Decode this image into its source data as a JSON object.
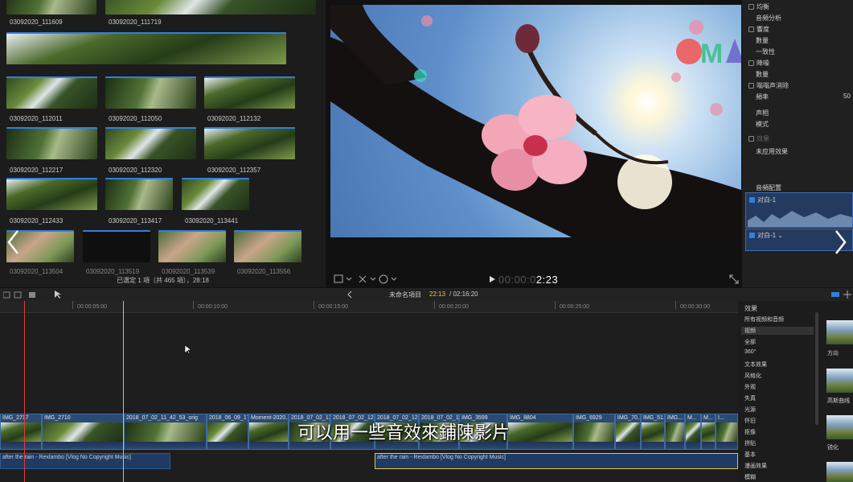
{
  "browser": {
    "clips": [
      {
        "name": "03092020_111609"
      },
      {
        "name": "03092020_111719"
      },
      {
        "name": "03092020_112011"
      },
      {
        "name": "03092020_112050"
      },
      {
        "name": "03092020_112132"
      },
      {
        "name": "03092020_112217"
      },
      {
        "name": "03092020_112320"
      },
      {
        "name": "03092020_112357"
      },
      {
        "name": "03092020_112433"
      },
      {
        "name": "03092020_113417"
      },
      {
        "name": "03092020_113441"
      },
      {
        "name": "03092020_113504"
      },
      {
        "name": "03092020_113519"
      },
      {
        "name": "03092020_113539"
      },
      {
        "name": "03092020_113556"
      }
    ],
    "status": "已選定 1 項（共 465 項），28:18"
  },
  "viewer": {
    "timecode_dim": "00:00:0",
    "timecode": "2:23",
    "logo_text": "OM"
  },
  "inspector": {
    "rows": [
      "均衡",
      "音頻分析",
      "響度",
      "數量",
      "一致性",
      "降噪",
      "數量",
      "嗡嗡声消除",
      "頻率",
      "声相",
      "模式",
      "效果",
      "未应用效果",
      "音頻配置"
    ],
    "freq_value": "50",
    "roles": [
      "对白-1",
      "对白-1"
    ]
  },
  "toolbar": {
    "project_name": "未命名項目",
    "time_current": "22:13",
    "time_total": "/ 02:16:20"
  },
  "timeline": {
    "ruler": [
      "00:00:05:00",
      "00:00:10:00",
      "00:00:15:00",
      "00:00:20:00",
      "00:00:25:00",
      "00:00:30:00"
    ],
    "video_clips": [
      "IMG_2717",
      "IMG_2710",
      "2018_07_02_11_42_53_orig",
      "2018_06_09_17...",
      "Moment-2020...",
      "2018_07_02_13...",
      "2018_07_02_12...",
      "2018_07_02_12...",
      "2018_07_02_11...",
      "IMG_3599",
      "IMG_8804",
      "IMG_6929",
      "IMG_70...",
      "IMG_51...",
      "IMG...",
      "M...",
      "M...",
      "I..."
    ],
    "audio_clips": [
      "after the rain - Rexlambo [Vlog No Copyright Music]",
      "after the rain - Rexlambo [Vlog No Copyright Music]"
    ],
    "subtitle": "可以用一些音效來鋪陳影片"
  },
  "effects": {
    "title": "效果",
    "items": [
      "所有视频和音频",
      "视频",
      "全部",
      "360°",
      "文本效果",
      "风格化",
      "外观",
      "失真",
      "光源",
      "怀旧",
      "抠像",
      "拼贴",
      "基本",
      "漫画效果",
      "模糊"
    ],
    "thumbs": [
      "方向",
      "高斯曲线",
      "锐化"
    ]
  },
  "colors": {
    "accent": "#2f7fe0",
    "timeline_clip": "#2b4a73",
    "playhead": "#e23b3b",
    "selected_audio": "#e8c347"
  }
}
